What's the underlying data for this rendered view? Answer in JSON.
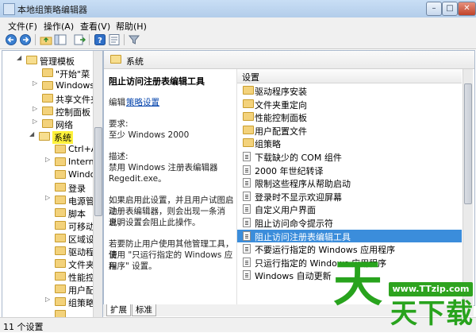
{
  "window": {
    "title": "本地组策略编辑器",
    "min": "–",
    "max": "□",
    "close": "✕"
  },
  "menu": [
    "文件(F)",
    "操作(A)",
    "查看(V)",
    "帮助(H)"
  ],
  "toolbar_icons": [
    "back-icon",
    "forward-icon",
    "up-folder-icon",
    "show-hide-tree-icon",
    "export-list-icon",
    "help-icon",
    "properties-icon",
    "filter-icon"
  ],
  "tree": {
    "items": [
      {
        "label": "管理模板",
        "expander": "◢",
        "open": true
      },
      {
        "label": "\"开始\"菜",
        "expander": "",
        "open": false
      },
      {
        "label": "Windows",
        "expander": "▷",
        "open": false
      },
      {
        "label": "共享文件夹",
        "expander": "",
        "open": false
      },
      {
        "label": "控制面板",
        "expander": "▷",
        "open": false
      },
      {
        "label": "网络",
        "expander": "▷",
        "open": false
      },
      {
        "label": "系统",
        "expander": "◢",
        "open": true
      },
      {
        "label": "Ctrl+A",
        "expander": "",
        "open": false
      },
      {
        "label": "Intern",
        "expander": "▷",
        "open": false
      },
      {
        "label": "Windo",
        "expander": "",
        "open": false
      },
      {
        "label": "登录",
        "expander": "",
        "open": false
      },
      {
        "label": "电源管",
        "expander": "▷",
        "open": false
      },
      {
        "label": "脚本",
        "expander": "",
        "open": false
      },
      {
        "label": "可移动",
        "expander": "",
        "open": false
      },
      {
        "label": "区域设",
        "expander": "",
        "open": false
      },
      {
        "label": "驱动程",
        "expander": "",
        "open": false
      },
      {
        "label": "文件夹",
        "expander": "",
        "open": false
      },
      {
        "label": "性能控",
        "expander": "",
        "open": false
      },
      {
        "label": "用户配",
        "expander": "",
        "open": false
      },
      {
        "label": "组策略",
        "expander": "▷",
        "open": false
      },
      {
        "label": "",
        "expander": "",
        "open": false
      }
    ]
  },
  "right": {
    "crumb": "系统",
    "desc": {
      "title": "阻止访问注册表编辑工具",
      "edit_prefix": "编辑",
      "edit_link": "策略设置",
      "req_label": "要求:",
      "req_value": "至少 Windows 2000",
      "desc_label": "描述:",
      "desc_lines": [
        "禁用 Windows 注册表编辑器",
        "Regedit.exe。"
      ],
      "para2": [
        "如果启用此设置，并且用户试图启动",
        "注册表编辑器，则会出现一条消息，",
        "说明设置会阻止此操作。"
      ],
      "para3": [
        "若要防止用户使用其他管理工具，请",
        "使用 \"只运行指定的 Windows 应用",
        "程序\" 设置。"
      ]
    },
    "list": {
      "header": "设置",
      "items": [
        {
          "label": "驱动程序安装",
          "type": "folder"
        },
        {
          "label": "文件夹重定向",
          "type": "folder"
        },
        {
          "label": "性能控制面板",
          "type": "folder"
        },
        {
          "label": "用户配置文件",
          "type": "folder"
        },
        {
          "label": "组策略",
          "type": "folder"
        },
        {
          "label": "下载缺少的 COM 组件",
          "type": "policy"
        },
        {
          "label": "2000 年世纪转译",
          "type": "policy"
        },
        {
          "label": "限制这些程序从帮助启动",
          "type": "policy"
        },
        {
          "label": "登录时不显示欢迎屏幕",
          "type": "policy"
        },
        {
          "label": "自定义用户界面",
          "type": "policy"
        },
        {
          "label": "阻止访问命令提示符",
          "type": "policy"
        },
        {
          "label": "阻止访问注册表编辑工具",
          "type": "policy",
          "selected": true
        },
        {
          "label": "不要运行指定的 Windows 应用程序",
          "type": "policy"
        },
        {
          "label": "只运行指定的 Windows 应用程序",
          "type": "policy"
        },
        {
          "label": "Windows 自动更新",
          "type": "policy"
        }
      ]
    },
    "tabs": [
      "扩展",
      "标准"
    ]
  },
  "status": "11 个设置",
  "watermark": {
    "url": "www.TTzip.com",
    "big": "天",
    "small": "天下载"
  },
  "colors": {
    "selection": "#3b8ddb",
    "highlight": "#fff23b",
    "watermark": "#28a31d"
  }
}
